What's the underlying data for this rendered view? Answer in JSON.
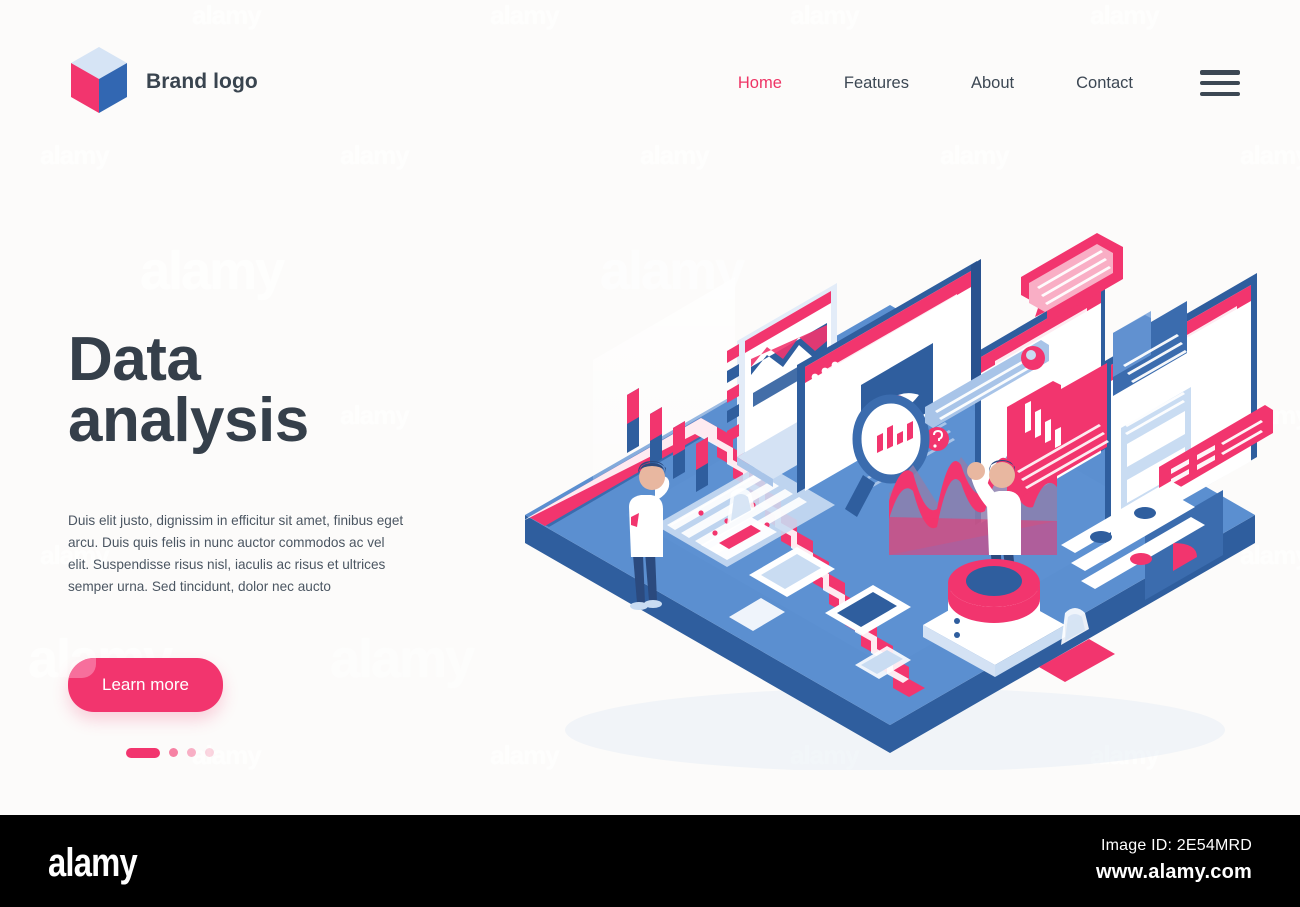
{
  "page": {
    "background_color": "#FCFBFA",
    "watermark_text": "alamy"
  },
  "header": {
    "brand": {
      "logo_icon": "cube-logo-icon",
      "name": "Brand logo",
      "colors": {
        "top": "#D6E4F5",
        "left": "#F2356E",
        "right": "#3267B2"
      }
    },
    "nav": {
      "items": [
        {
          "label": "Home",
          "active": true
        },
        {
          "label": "Features",
          "active": false
        },
        {
          "label": "About",
          "active": false
        },
        {
          "label": "Contact",
          "active": false
        }
      ],
      "active_color": "#EE3465",
      "inactive_color": "#3C4753",
      "menu_icon": "hamburger-menu-icon"
    }
  },
  "hero": {
    "headline_line1": "Data",
    "headline_line2": "analysis",
    "headline_color": "#353F4A",
    "body": "Duis elit justo, dignissim in efficitur sit amet, finibus eget arcu. Duis quis felis in nunc auctor commodos ac vel elit. Suspendisse risus nisl, iaculis ac risus et ultrices semper urna. Sed tincidunt, dolor nec aucto",
    "cta_label": "Learn more",
    "cta_color": "#F2356E",
    "carousel": {
      "total": 4,
      "active_index": 1
    }
  },
  "illustration": {
    "name": "isometric-data-analysis-illustration",
    "palette": {
      "pink": "#F2356E",
      "pink_light": "#F87FA5",
      "blue_deep": "#29528F",
      "blue": "#3B6CAE",
      "blue_mid": "#5B8FD0",
      "blue_light": "#A8C4E8",
      "blue_pale": "#D4E2F4",
      "white": "#FFFFFF",
      "off_white": "#F4F7FC",
      "purple": "#8C7FAE"
    },
    "elements": [
      "isometric-platform-base",
      "pink-zigzag-stair-stripe",
      "person-left-standing",
      "person-right-adjusting-chart",
      "bar-chart-panel",
      "laptop-with-area-chart",
      "browser-window-magnifier",
      "browser-window-eye-icon",
      "magnifier-with-bar-chart",
      "wave-area-chart",
      "database-cylinder-stack",
      "pink-folder-bar-chart",
      "blue-folder-pie-chart",
      "chat-bubble-pink",
      "blue-folder-floating",
      "slider-controls",
      "funnel-icon",
      "spreadsheet-grid",
      "tablet-screens"
    ]
  },
  "footer": {
    "logo_text": "alamy",
    "image_id": "Image ID: 2E54MRD",
    "site_url": "www.alamy.com",
    "background_color": "#000000"
  }
}
